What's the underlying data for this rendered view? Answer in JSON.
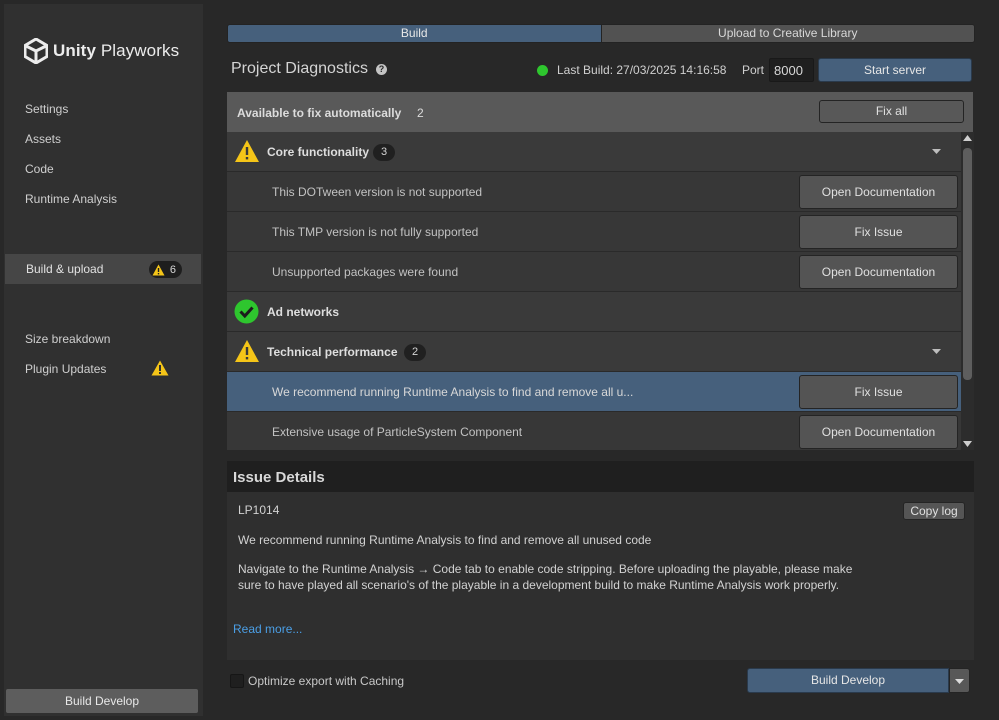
{
  "app": {
    "brand_bold": "Unity",
    "brand_rest": " Playworks"
  },
  "sidebar": {
    "items": [
      {
        "label": "Settings"
      },
      {
        "label": "Assets"
      },
      {
        "label": "Code"
      },
      {
        "label": "Runtime Analysis"
      },
      {
        "label": "Build & upload",
        "active": true,
        "warning_count": "6"
      },
      {
        "label": "Size breakdown"
      },
      {
        "label": "Plugin Updates",
        "icon": "warning-icon"
      }
    ],
    "build_button": "Build Develop"
  },
  "tabs": [
    {
      "label": "Build",
      "active": true
    },
    {
      "label": "Upload to Creative Library"
    }
  ],
  "diagnostics": {
    "title": "Project Diagnostics",
    "help_glyph": "?",
    "status_color": "#2ec62e",
    "last_build": "Last Build: 27/03/2025 14:16:58",
    "port_label": "Port",
    "port_value": "8000",
    "start_server": "Start server"
  },
  "auto_fix": {
    "label": "Available to fix automatically",
    "count": "2",
    "button": "Fix all"
  },
  "categories": [
    {
      "label": "Core functionality",
      "icon": "warning-icon",
      "count": "3",
      "items": [
        {
          "text": "This DOTween version is not supported",
          "action": "Open Documentation"
        },
        {
          "text": "This TMP version is not fully supported",
          "action": "Fix Issue"
        },
        {
          "text": "Unsupported packages were found",
          "action": "Open Documentation"
        }
      ]
    },
    {
      "label": "Ad networks",
      "icon": "check-icon"
    },
    {
      "label": "Technical performance",
      "icon": "warning-icon",
      "count": "2",
      "items": [
        {
          "text": "We recommend running Runtime Analysis to find and remove all u...",
          "action": "Fix Issue",
          "selected": true
        },
        {
          "text": "Extensive usage of ParticleSystem Component",
          "action": "Open Documentation"
        }
      ]
    }
  ],
  "details": {
    "header": "Issue Details",
    "code": "LP1014",
    "copy_log": "Copy log",
    "summary": "We recommend running Runtime Analysis to find and remove all unused code",
    "description": "Navigate to the Runtime Analysis → Code tab to enable code stripping. Before uploading the playable, please make sure to have played all scenario's of the playable in a development build to make Runtime Analysis work properly.",
    "read_more": "Read more..."
  },
  "footer": {
    "cache_label": "Optimize export with Caching",
    "cache_checked": false,
    "build_button": "Build Develop"
  },
  "colors": {
    "accent": "#46607c",
    "warning": "#f5c518",
    "ok": "#2ec62e",
    "link": "#4b9fe6"
  }
}
